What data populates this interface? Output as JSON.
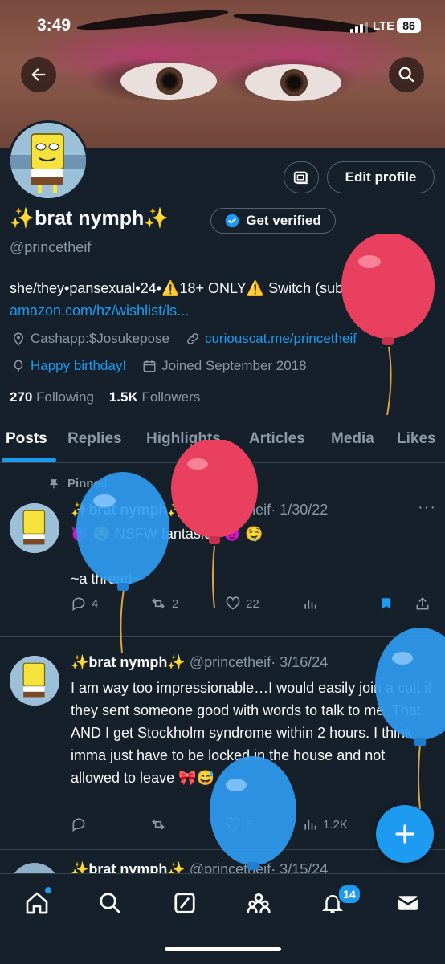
{
  "status_bar": {
    "time": "3:49",
    "network": "LTE",
    "battery": "86"
  },
  "profile": {
    "actions": {
      "edit_profile": "Edit profile"
    },
    "display_name": "✨brat nymph✨",
    "get_verified": "Get verified",
    "handle": "@princetheif",
    "bio_text": "she/they•pansexual•24•⚠️18+ ONLY⚠️ Switch (sub+)•",
    "bio_link": "amazon.com/hz/wishlist/ls...",
    "location": "Cashapp:$Josukepose",
    "website": "curiouscat.me/princetheif",
    "birthday": "Happy birthday!",
    "joined": "Joined September 2018",
    "following_count": "270",
    "following_label": "Following",
    "followers_count": "1.5K",
    "followers_label": "Followers"
  },
  "tabs": [
    "Posts",
    "Replies",
    "Highlights",
    "Articles",
    "Media",
    "Likes"
  ],
  "posts": [
    {
      "pinned_label": "Pinned",
      "name": "✨brat nymph✨",
      "handle": "@princetheif",
      "date": "· 1/30/22",
      "text_line1": "😈 🤤 NSFW fantasies 😈 🤤",
      "text_line2": "~a thread~",
      "replies": "4",
      "reposts": "2",
      "likes": "22"
    },
    {
      "name": "✨brat nymph✨",
      "handle": "@princetheif",
      "date": "· 3/16/24",
      "text": "I am way too impressionable…I would easily join a cult if they sent someone good with words to talk to me. That AND I get Stockholm syndrome within 2 hours. I think imma just have to be locked in the house and not allowed to leave 🎀😅",
      "likes": "6",
      "views": "1.2K"
    },
    {
      "name": "✨brat nymph✨",
      "handle": "@princetheif",
      "date": "· 3/15/24"
    }
  ],
  "bottom_nav": {
    "notifications_badge": "14"
  },
  "colors": {
    "background": "#15202b",
    "accent": "#1d9bf0",
    "muted": "#8b98a5",
    "balloon_red": "#e8405e",
    "balloon_blue": "#2e9bf0"
  }
}
